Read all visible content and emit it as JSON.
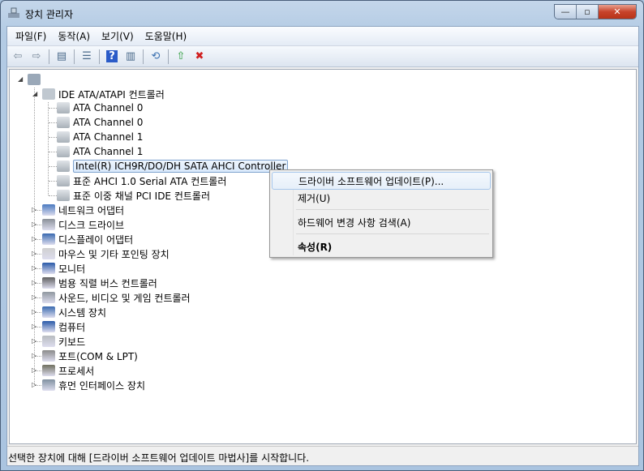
{
  "window": {
    "title": "장치 관리자",
    "minimize": "—",
    "maximize": "▫",
    "close": "✕"
  },
  "menu": [
    "파일(F)",
    "동작(A)",
    "보기(V)",
    "도움말(H)"
  ],
  "toolbar": [
    {
      "icon": "back-icon",
      "g": "⇦"
    },
    {
      "icon": "forward-icon",
      "g": "⇨"
    },
    {
      "sep": true
    },
    {
      "icon": "show-hide-console-tree-icon",
      "g": "▤"
    },
    {
      "sep": true
    },
    {
      "icon": "properties-icon",
      "g": "☰"
    },
    {
      "sep": true
    },
    {
      "icon": "help-icon",
      "g": "?"
    },
    {
      "icon": "show-action-pane-icon",
      "g": "▥"
    },
    {
      "sep": true
    },
    {
      "icon": "scan-hardware-icon",
      "g": "⟲"
    },
    {
      "sep": true
    },
    {
      "icon": "update-driver-icon",
      "g": "⇧"
    },
    {
      "icon": "uninstall-icon",
      "g": "✖"
    }
  ],
  "tree": {
    "root": "",
    "ide": {
      "label": "IDE ATA/ATAPI 컨트롤러",
      "children": [
        "ATA Channel 0",
        "ATA Channel 0",
        "ATA Channel 1",
        "ATA Channel 1",
        "Intel(R) ICH9R/DO/DH SATA AHCI Controller",
        "표준 AHCI 1.0 Serial ATA 컨트롤러",
        "표준 이중 채널 PCI IDE 컨트롤러"
      ],
      "selected_index": 4
    },
    "categories": [
      "네트워크 어댑터",
      "디스크 드라이브",
      "디스플레이 어댑터",
      "마우스 및 기타 포인팅 장치",
      "모니터",
      "범용 직렬 버스 컨트롤러",
      "사운드, 비디오 및 게임 컨트롤러",
      "시스템 장치",
      "컴퓨터",
      "키보드",
      "포트(COM & LPT)",
      "프로세서",
      "휴먼 인터페이스 장치"
    ]
  },
  "context_menu": [
    "드라이버 소프트웨어 업데이트(P)...",
    "제거(U)",
    "하드웨어 변경 사항 검색(A)",
    "속성(R)"
  ],
  "status": "선택한 장치에 대해 [드라이버 소프트웨어 업데이트 마법사]를 시작합니다."
}
